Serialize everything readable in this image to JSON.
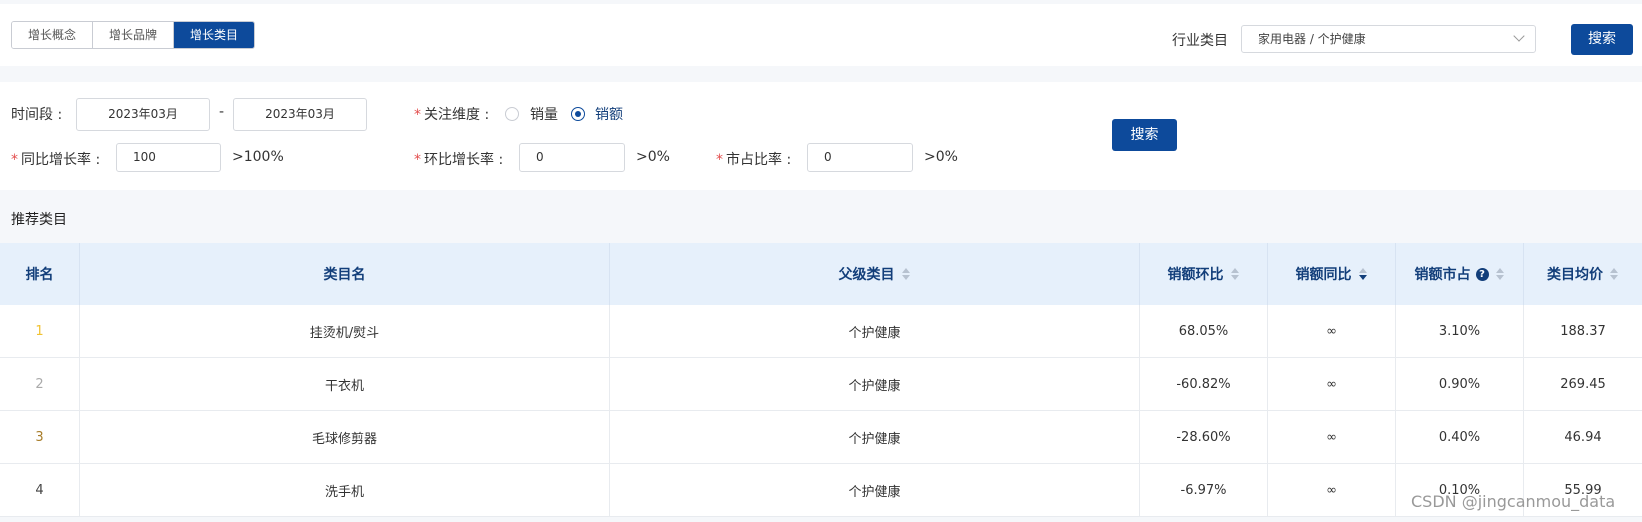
{
  "tabs": [
    {
      "label": "增长概念",
      "active": false
    },
    {
      "label": "增长品牌",
      "active": false
    },
    {
      "label": "增长类目",
      "active": true
    }
  ],
  "industry": {
    "label": "行业类目",
    "value": "家用电器 / 个护健康",
    "search_label": "搜索"
  },
  "filters": {
    "period": {
      "label": "时间段 :",
      "start": "2023年03月",
      "separator": "-",
      "end": "2023年03月"
    },
    "dimension": {
      "label": "关注维度 :",
      "options": [
        {
          "label": "销量",
          "selected": false
        },
        {
          "label": "销额",
          "selected": true
        }
      ]
    },
    "yoy": {
      "label": "同比增长率 :",
      "value": "100",
      "suffix": ">100%"
    },
    "mom": {
      "label": "环比增长率 :",
      "value": "0",
      "suffix": ">0%"
    },
    "share": {
      "label": "市占比率 :",
      "value": "0",
      "suffix": ">0%"
    },
    "required_mark": "*",
    "search_label": "搜索"
  },
  "section_title": "推荐类目",
  "table": {
    "columns": [
      "排名",
      "类目名",
      "父级类目",
      "销额环比",
      "销额同比",
      "销额市占",
      "类目均价"
    ],
    "rows": [
      {
        "rank": "1",
        "rank_color": "#f1c232",
        "name": "挂烫机/熨斗",
        "parent": "个护健康",
        "mom": "68.05%",
        "yoy": "∞",
        "share": "3.10%",
        "price": "188.37"
      },
      {
        "rank": "2",
        "rank_color": "#aaaaaa",
        "name": "干衣机",
        "parent": "个护健康",
        "mom": "-60.82%",
        "yoy": "∞",
        "share": "0.90%",
        "price": "269.45"
      },
      {
        "rank": "3",
        "rank_color": "#a87d2a",
        "name": "毛球修剪器",
        "parent": "个护健康",
        "mom": "-28.60%",
        "yoy": "∞",
        "share": "0.40%",
        "price": "46.94"
      },
      {
        "rank": "4",
        "rank_color": "#444444",
        "name": "洗手机",
        "parent": "个护健康",
        "mom": "-6.97%",
        "yoy": "∞",
        "share": "0.10%",
        "price": "55.99"
      }
    ]
  },
  "help_icon": "?",
  "watermark": "CSDN @jingcanmou_data"
}
